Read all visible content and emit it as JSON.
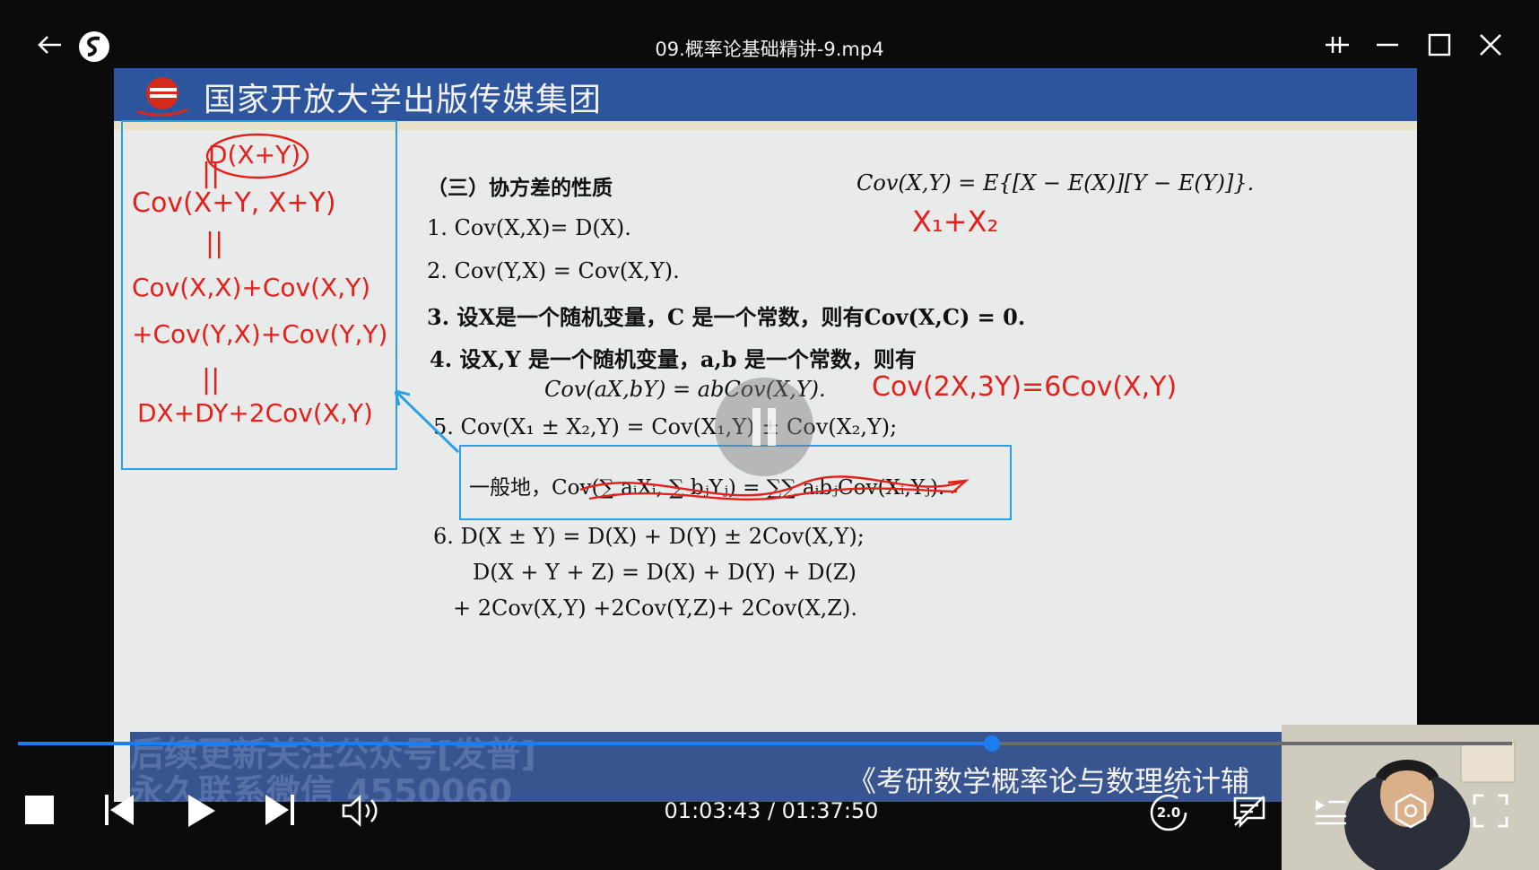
{
  "window": {
    "title": "09.概率论基础精讲-9.mp4"
  },
  "slide": {
    "publisher": "国家开放大学出版传媒集团",
    "heading": "（三）协方差的性质",
    "definition": "Cov(X,Y) = E{[X − E(X)][Y − E(Y)]}.",
    "items": [
      "1.  Cov(X,X)= D(X).",
      "2.  Cov(Y,X) = Cov(X,Y).",
      "3.  设X是一个随机变量，C 是一个常数，则有Cov(X,C) = 0.",
      "4.  设X,Y 是一个随机变量，a,b 是一个常数，则有",
      "Cov(aX,bY) = abCov(X,Y).",
      "5.  Cov(X₁ ± X₂,Y) = Cov(X₁,Y) ± Cov(X₂,Y);",
      "一般地，Cov(∑ aᵢXᵢ, ∑ bⱼYⱼ) = ∑∑ aᵢbⱼCov(Xᵢ,Yⱼ).",
      "6.  D(X ± Y)  = D(X) + D(Y) ± 2Cov(X,Y);",
      "D(X + Y + Z) = D(X) + D(Y) + D(Z)",
      "+ 2Cov(X,Y) +2Cov(Y,Z)+ 2Cov(X,Z)."
    ],
    "handwriting": {
      "left_box": [
        "D(X+Y)",
        "Cov(X+Y, X+Y)",
        "Cov(X,X)+Cov(X,Y)",
        "+Cov(Y,X)+Cov(Y,Y)",
        "DX+DY+2Cov(X,Y)"
      ],
      "def_note": "X₁+X₂",
      "item4_note": "Cov(2X,3Y)=6Cov(X,Y)"
    },
    "watermark_1": "后续更新关注公众号[发普]",
    "watermark_2": "永久联系微信 4550060",
    "book_title": "《考研数学概率论与数理统计辅"
  },
  "player": {
    "time": "01:03:43 / 01:37:50",
    "progress": 0.652,
    "speed": "2.0"
  },
  "colors": {
    "accent": "#1c7cf0",
    "annotation_red": "#e3201b",
    "annotation_blue": "#2aa0e6",
    "banner": "#2d559e"
  },
  "icons": {
    "back": "back-arrow-icon",
    "app_logo": "player-logo-icon",
    "pin": "pin-icon",
    "minimize": "minimize-icon",
    "maximize": "maximize-icon",
    "close": "close-icon",
    "stop": "stop-icon",
    "prev": "previous-icon",
    "play": "play-icon",
    "next": "next-icon",
    "volume": "volume-icon",
    "speed": "speed-icon",
    "danmaku": "danmaku-off-icon",
    "playlist": "playlist-icon",
    "settings": "settings-icon",
    "fullscreen": "fullscreen-icon"
  }
}
